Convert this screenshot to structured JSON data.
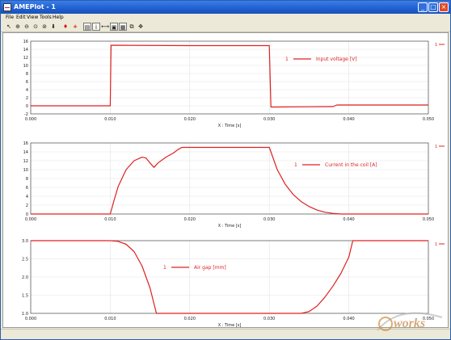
{
  "window": {
    "title": "AMEPlot - 1"
  },
  "menu": [
    "File",
    "Edit",
    "View",
    "Tools",
    "Help"
  ],
  "toolbar": {
    "icons": [
      "pointer-icon",
      "zoom-in-icon",
      "zoom-out-icon",
      "zoom-x-icon",
      "zoom-y-icon",
      "download-icon",
      "red-marker-icon",
      "red-cross-icon",
      "table-icon",
      "info-icon",
      "axis-icon",
      "export-image-icon",
      "grid-icon",
      "copy-icon",
      "pan-icon"
    ]
  },
  "colors": {
    "trace": "#e02020",
    "grid": "#e3e3e3",
    "axis": "#4a4a4a"
  },
  "chart_data": [
    {
      "type": "line",
      "xlabel": "X : Time [s]",
      "ylabel": "",
      "xlim": [
        0.0,
        0.05
      ],
      "ylim": [
        -2,
        16
      ],
      "xticks": [
        "0.000",
        "0.010",
        "0.020",
        "0.030",
        "0.040",
        "0.050"
      ],
      "yticks": [
        "-2",
        "0",
        "2",
        "4",
        "6",
        "8",
        "10",
        "12",
        "14",
        "16"
      ],
      "grid": true,
      "legend_position": "top-right",
      "series": [
        {
          "name": "Input voltage [V]",
          "legend_id": "1",
          "x": [
            0.0,
            0.01,
            0.0101,
            0.02,
            0.03,
            0.0302,
            0.0305,
            0.038,
            0.0385,
            0.05
          ],
          "y": [
            0.0,
            0.0,
            15.0,
            14.9,
            14.9,
            -0.3,
            -0.3,
            -0.2,
            0.2,
            0.2
          ]
        }
      ]
    },
    {
      "type": "line",
      "xlabel": "X : Time [s]",
      "ylabel": "",
      "xlim": [
        0.0,
        0.05
      ],
      "ylim": [
        0,
        16
      ],
      "xticks": [
        "0.000",
        "0.010",
        "0.020",
        "0.030",
        "0.040",
        "0.050"
      ],
      "yticks": [
        "0",
        "2",
        "4",
        "6",
        "8",
        "10",
        "12",
        "14",
        "16"
      ],
      "grid": true,
      "legend_position": "right",
      "series": [
        {
          "name": "Current in the coil [A]",
          "legend_id": "1",
          "x": [
            0.0,
            0.01,
            0.0105,
            0.011,
            0.012,
            0.013,
            0.014,
            0.0145,
            0.015,
            0.0155,
            0.016,
            0.017,
            0.018,
            0.0185,
            0.019,
            0.02,
            0.025,
            0.03,
            0.031,
            0.032,
            0.033,
            0.034,
            0.035,
            0.036,
            0.037,
            0.038,
            0.039,
            0.05
          ],
          "y": [
            0.0,
            0.0,
            3.2,
            6.2,
            10.0,
            12.0,
            12.8,
            12.6,
            11.5,
            10.5,
            11.5,
            12.8,
            13.8,
            14.5,
            15.0,
            15.0,
            15.0,
            15.0,
            10.0,
            6.7,
            4.4,
            2.8,
            1.7,
            0.9,
            0.4,
            0.15,
            0.0,
            0.0
          ]
        }
      ]
    },
    {
      "type": "line",
      "xlabel": "X : Time [s]",
      "ylabel": "",
      "xlim": [
        0.0,
        0.05
      ],
      "ylim": [
        1.0,
        3.0
      ],
      "xticks": [
        "0.000",
        "0.010",
        "0.020",
        "0.030",
        "0.040",
        "0.050"
      ],
      "yticks": [
        "1.0",
        "1.5",
        "2.0",
        "2.5",
        "3.0"
      ],
      "grid": true,
      "legend_position": "left",
      "series": [
        {
          "name": "Air gap [mm]",
          "legend_id": "1",
          "x": [
            0.0,
            0.01,
            0.011,
            0.012,
            0.013,
            0.014,
            0.015,
            0.0158,
            0.02,
            0.03,
            0.034,
            0.035,
            0.036,
            0.037,
            0.038,
            0.039,
            0.04,
            0.0405,
            0.05
          ],
          "y": [
            3.0,
            3.0,
            2.98,
            2.9,
            2.7,
            2.3,
            1.7,
            1.0,
            1.0,
            1.0,
            1.0,
            1.05,
            1.2,
            1.45,
            1.75,
            2.1,
            2.55,
            3.0,
            3.0
          ]
        }
      ]
    }
  ]
}
